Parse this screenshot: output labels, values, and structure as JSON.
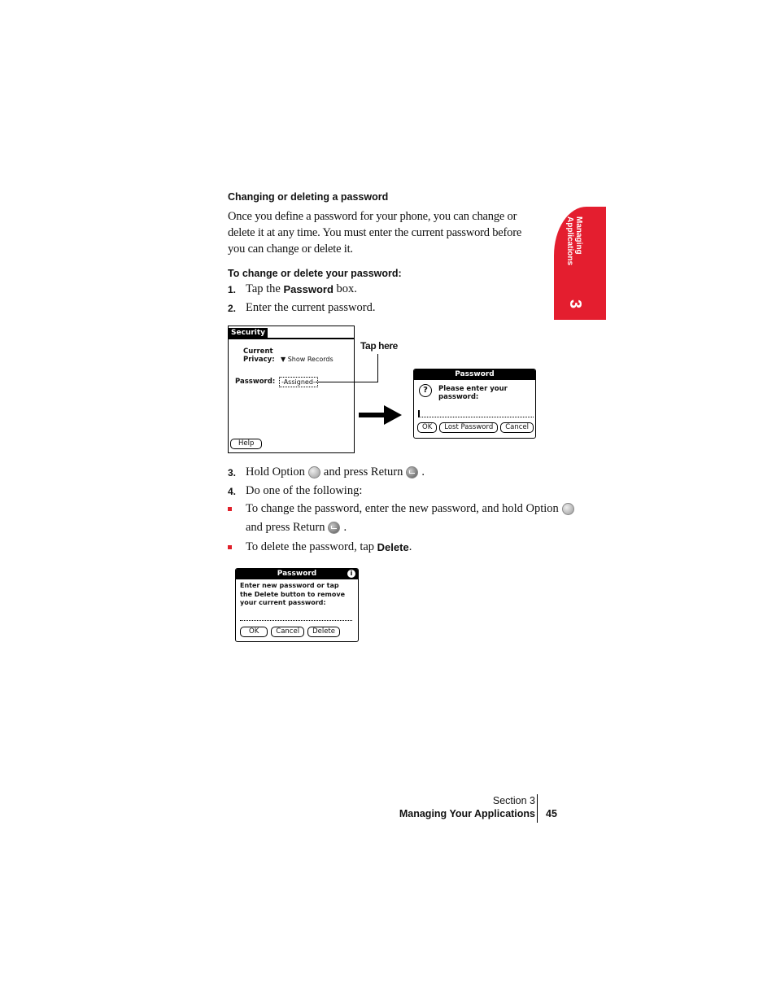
{
  "section_heading": "Changing or deleting a password",
  "intro": "Once you define a password for your phone, you can change or delete it at any time. You must enter the current password before you can change or delete it.",
  "procedure_heading": "To change or delete your password:",
  "steps": [
    {
      "num": "1.",
      "pre": "Tap the ",
      "bold": "Password",
      "post": " box."
    },
    {
      "num": "2.",
      "text": "Enter the current password."
    },
    {
      "num": "3.",
      "pre": "Hold Option",
      "mid": "and press Return",
      "post": "."
    },
    {
      "num": "4.",
      "text": "Do one of the following:"
    }
  ],
  "bullets": [
    {
      "line1": "To change the password, enter the new password, and hold Option",
      "line2": "and press Return",
      "post": "."
    },
    {
      "pre": "To delete the password, tap ",
      "bold": "Delete",
      "post": "."
    }
  ],
  "callout": "Tap here",
  "security_screen": {
    "tab": "Security",
    "privacy_label_1": "Current",
    "privacy_label_2": "Privacy:",
    "privacy_value": "Show Records",
    "password_label": "Password:",
    "password_value": "-Assigned-",
    "help_button": "Help"
  },
  "password_dialog": {
    "title": "Password",
    "prompt_1": "Please enter your",
    "prompt_2": "password:",
    "buttons": [
      "OK",
      "Lost Password",
      "Cancel"
    ]
  },
  "new_password_dialog": {
    "title": "Password",
    "message": [
      "Enter new password or tap",
      "the Delete button to remove",
      "your current password:"
    ],
    "buttons": [
      "OK",
      "Cancel",
      "Delete"
    ]
  },
  "side_tab": {
    "label_1": "Managing",
    "label_2": "Applications",
    "number": "3",
    "color": "#e41e2f"
  },
  "footer": {
    "section": "Section 3",
    "chapter": "Managing Your Applications",
    "page": "45"
  }
}
